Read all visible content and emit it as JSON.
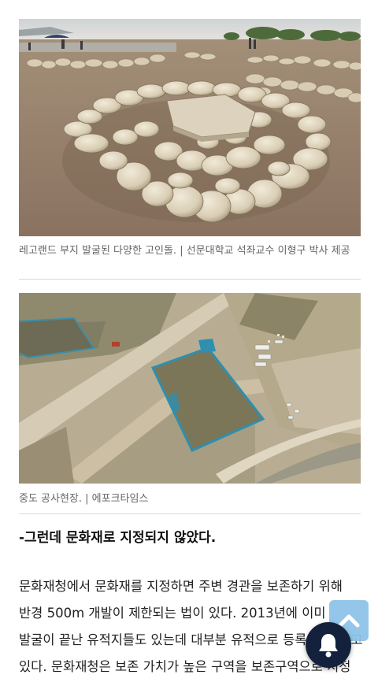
{
  "article": {
    "figure1": {
      "caption": "레고랜드 부지 발굴된 다양한 고인돌. | 선문대학교 석좌교수 이형구 박사 제공",
      "image_desc_icon": "photo-dolmens"
    },
    "figure2": {
      "caption": "중도 공사현장. | 에포크타임스",
      "image_desc_icon": "photo-construction-site"
    },
    "subheading": "-그런데 문화재로 지정되지 않았다.",
    "paragraph": "문화재청에서 문화재를 지정하면 주변 경관을 보존하기 위해 반경 500m 개발이 제한되는 법이 있다. 2013년에 이미 발굴이 끝난 유적지들도 있는데 대부분 유적으로 등록을 안 하고 있다. 문화재청은 보존 가치가 높은 구역을 보존구역으로 지정"
  },
  "floating": {
    "scroll_top_icon": "chevron-up-icon",
    "notification_icon": "bell-icon"
  },
  "colors": {
    "caption": "#666666",
    "scroll_top_bg": "#8fc3e8",
    "bell_bg": "#14213d"
  }
}
